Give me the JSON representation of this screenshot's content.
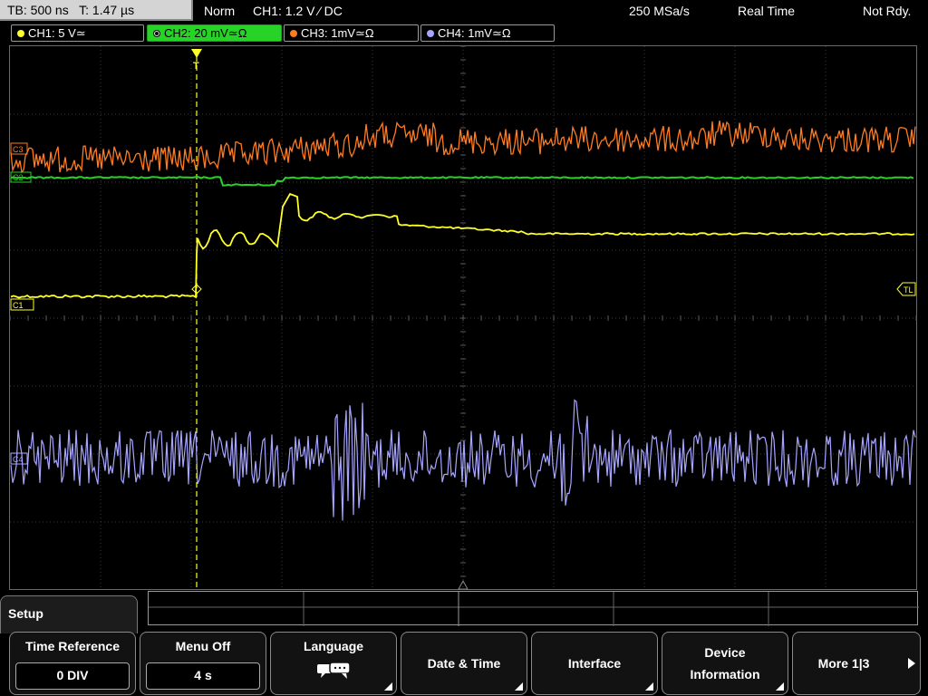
{
  "status": {
    "timebase": "TB: 500 ns",
    "trigger_time": "T: 1.47 µs",
    "mode": "Norm",
    "trigger_source": "CH1: 1.2 V ⁄ DC",
    "sample_rate": "250 MSa/s",
    "acq_mode": "Real Time",
    "ready_state": "Not Rdy."
  },
  "channels": [
    {
      "label": "CH1: 5 V≃",
      "color": "#ffff2a",
      "active": false
    },
    {
      "label": "CH2: 20 mV≃Ω",
      "color": "#26d326",
      "active": true
    },
    {
      "label": "CH3: 1mV≃Ω",
      "color": "#ff7b1f",
      "active": false
    },
    {
      "label": "CH4: 1mV≃Ω",
      "color": "#a7a5ff",
      "active": false
    }
  ],
  "markers": {
    "ch1": "C1",
    "ch2": "C2",
    "ch3": "C3",
    "ch4": "C4",
    "trigger_level": "TL",
    "trigger_position": "T"
  },
  "menu": {
    "title": "Setup",
    "softkeys": [
      {
        "label": "Time Reference",
        "value": "0 DIV"
      },
      {
        "label": "Menu Off",
        "value": "4 s"
      },
      {
        "label": "Language",
        "icon": "speech-bubbles-icon"
      },
      {
        "label": "Date & Time"
      },
      {
        "label": "Interface"
      },
      {
        "label_line1": "Device",
        "label_line2": "Information"
      },
      {
        "label": "More 1|3"
      }
    ]
  }
}
